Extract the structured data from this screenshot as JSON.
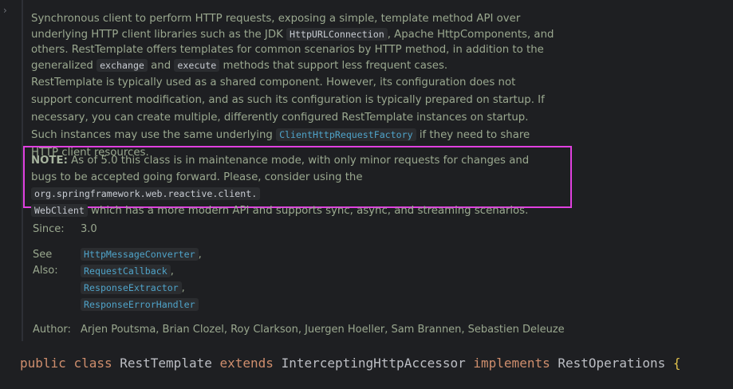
{
  "doc": {
    "p1_a": "Synchronous client to perform HTTP requests, exposing a simple, template method API over underlying HTTP client libraries such as the JDK ",
    "p1_code1": "HttpURLConnection",
    "p1_b": ", Apache HttpComponents, and others. RestTemplate offers templates for common scenarios by HTTP method, in addition to the generalized ",
    "p1_code2": "exchange",
    "p1_c": " and ",
    "p1_code3": "execute",
    "p1_d": " methods that support less frequent cases.",
    "p2_a": "RestTemplate is typically used as a shared component. However, its configuration does not support concurrent modification, and as such its configuration is typically prepared on startup. If necessary, you can create multiple, differently configured RestTemplate instances on startup. Such instances may use the same underlying ",
    "p2_link": "ClientHttpRequestFactory",
    "p2_b": " if they need to share HTTP client resources."
  },
  "note": {
    "label": "NOTE:",
    "text_a": " As of 5.0 this class is in maintenance mode, with only minor requests for changes and bugs to be accepted going forward. Please, consider using the ",
    "code1": "org.springframework.web.reactive.client.",
    "code2": "WebClient",
    "text_b": " which has a more modern API and supports sync, async, and streaming scenarios."
  },
  "since": {
    "label": "Since:",
    "value": "3.0"
  },
  "see_also": {
    "label": "See Also:",
    "items": [
      "HttpMessageConverter",
      "RequestCallback",
      "ResponseExtractor",
      "ResponseErrorHandler"
    ],
    "sep": ","
  },
  "author": {
    "label": "Author:",
    "value": "Arjen Poutsma, Brian Clozel, Roy Clarkson, Juergen Hoeller, Sam Brannen, Sebastien Deleuze"
  },
  "declaration": {
    "kw_public": "public",
    "kw_class": "class",
    "name": "RestTemplate",
    "kw_extends": "extends",
    "superclass": "InterceptingHttpAccessor",
    "kw_implements": "implements",
    "iface": "RestOperations",
    "brace": "{"
  },
  "icons": {
    "fold": "chevron-right-icon"
  }
}
